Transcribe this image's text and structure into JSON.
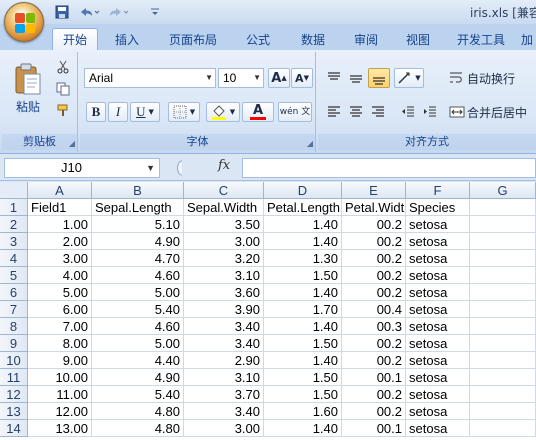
{
  "window": {
    "title": "iris.xls [兼容"
  },
  "quick_access": {
    "save_icon": "save-icon",
    "undo_icon": "undo-icon",
    "redo_icon": "redo-icon",
    "customize_icon": "customize-icon"
  },
  "tabs": [
    "开始",
    "插入",
    "页面布局",
    "公式",
    "数据",
    "审阅",
    "视图",
    "开发工具",
    "加"
  ],
  "active_tab": "开始",
  "ribbon": {
    "clipboard": {
      "label": "剪贴板",
      "paste_label": "粘贴"
    },
    "font": {
      "label": "字体",
      "font_name": "Arial",
      "font_size": "10",
      "bold": "B",
      "italic": "I",
      "underline": "U",
      "grow": "A",
      "shrink": "A",
      "font_color": "A",
      "phonetic": "wén 文",
      "fill_color": "#ffff00",
      "text_color": "#ff0000"
    },
    "alignment": {
      "label": "对齐方式",
      "wrap_text": "自动换行",
      "merge_center": "合并后居中"
    }
  },
  "formula_bar": {
    "name_box": "J10",
    "fx_label": "fx",
    "content": ""
  },
  "sheet": {
    "columns": [
      "A",
      "B",
      "C",
      "D",
      "E",
      "F",
      "G"
    ],
    "rows": [
      [
        "Field1",
        "Sepal.Length",
        "Sepal.Width",
        "Petal.Length",
        "Petal.Widt",
        "Species",
        ""
      ],
      [
        "1.00",
        "5.10",
        "3.50",
        "1.40",
        "00.2",
        "setosa",
        ""
      ],
      [
        "2.00",
        "4.90",
        "3.00",
        "1.40",
        "00.2",
        "setosa",
        ""
      ],
      [
        "3.00",
        "4.70",
        "3.20",
        "1.30",
        "00.2",
        "setosa",
        ""
      ],
      [
        "4.00",
        "4.60",
        "3.10",
        "1.50",
        "00.2",
        "setosa",
        ""
      ],
      [
        "5.00",
        "5.00",
        "3.60",
        "1.40",
        "00.2",
        "setosa",
        ""
      ],
      [
        "6.00",
        "5.40",
        "3.90",
        "1.70",
        "00.4",
        "setosa",
        ""
      ],
      [
        "7.00",
        "4.60",
        "3.40",
        "1.40",
        "00.3",
        "setosa",
        ""
      ],
      [
        "8.00",
        "5.00",
        "3.40",
        "1.50",
        "00.2",
        "setosa",
        ""
      ],
      [
        "9.00",
        "4.40",
        "2.90",
        "1.40",
        "00.2",
        "setosa",
        ""
      ],
      [
        "10.00",
        "4.90",
        "3.10",
        "1.50",
        "00.1",
        "setosa",
        ""
      ],
      [
        "11.00",
        "5.40",
        "3.70",
        "1.50",
        "00.2",
        "setosa",
        ""
      ],
      [
        "12.00",
        "4.80",
        "3.40",
        "1.60",
        "00.2",
        "setosa",
        ""
      ],
      [
        "13.00",
        "4.80",
        "3.00",
        "1.40",
        "00.1",
        "setosa",
        ""
      ]
    ]
  }
}
